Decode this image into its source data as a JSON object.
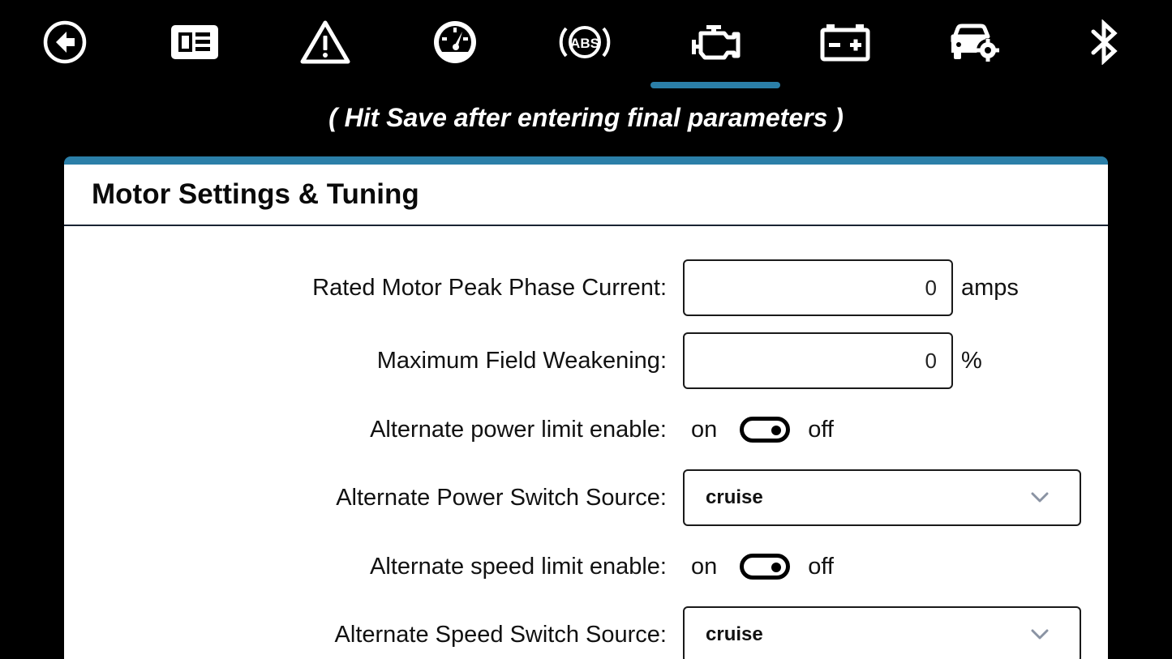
{
  "nav": {
    "items": [
      {
        "icon": "back-arrow-icon"
      },
      {
        "icon": "dashboard-card-icon"
      },
      {
        "icon": "warning-icon"
      },
      {
        "icon": "speedometer-icon"
      },
      {
        "icon": "abs-icon"
      },
      {
        "icon": "engine-icon",
        "active": true
      },
      {
        "icon": "battery-icon"
      },
      {
        "icon": "car-settings-icon"
      },
      {
        "icon": "bluetooth-icon"
      }
    ],
    "accent_color": "#2b7fa8"
  },
  "hint_text": "( Hit Save after entering final parameters )",
  "panel": {
    "title": "Motor Settings & Tuning",
    "rows": {
      "peak_current": {
        "label": "Rated Motor Peak Phase Current:",
        "value": "0",
        "unit": "amps"
      },
      "field_weakening": {
        "label": "Maximum Field Weakening:",
        "value": "0",
        "unit": "%"
      },
      "alt_power_enable": {
        "label": "Alternate power limit enable:",
        "on_label": "on",
        "off_label": "off",
        "state": "off"
      },
      "alt_power_source": {
        "label": "Alternate Power Switch Source:",
        "value": "cruise"
      },
      "alt_speed_enable": {
        "label": "Alternate speed limit enable:",
        "on_label": "on",
        "off_label": "off",
        "state": "off"
      },
      "alt_speed_source": {
        "label": "Alternate Speed Switch Source:",
        "value": "cruise"
      }
    }
  }
}
